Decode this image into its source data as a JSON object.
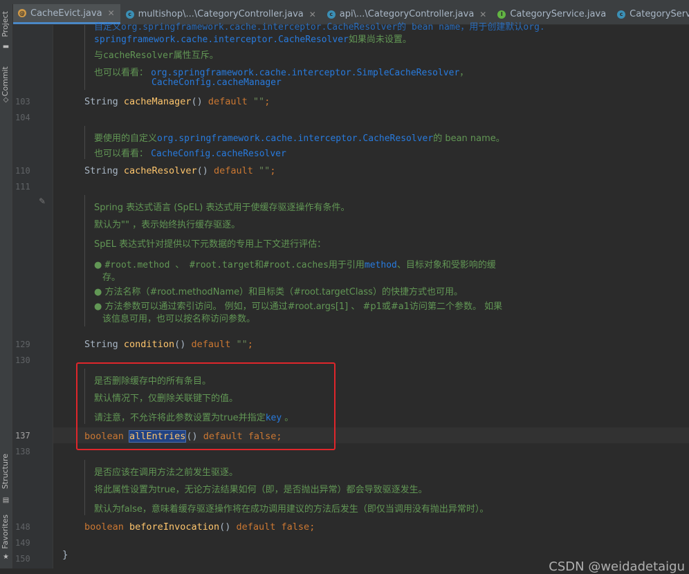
{
  "tabs": [
    {
      "label": "CacheEvict.java",
      "icon": "annotation-icon",
      "active": true,
      "closable": true
    },
    {
      "label": "multishop\\...\\CategoryController.java",
      "icon": "class-icon",
      "closable": true
    },
    {
      "label": "api\\...\\CategoryController.java",
      "icon": "class-icon",
      "closable": true
    },
    {
      "label": "CategoryService.java",
      "icon": "interface-icon",
      "closable": false
    },
    {
      "label": "CategoryServiceImpl.java",
      "icon": "class-icon",
      "closable": false
    }
  ],
  "close_glyph": "✕",
  "sidebar": {
    "project": "Project",
    "commit": "Commit",
    "structure": "Structure",
    "favorites": "Favorites"
  },
  "line_numbers": {
    "l103": "103",
    "l104": "104",
    "l110": "110",
    "l111": "111",
    "l129": "129",
    "l130": "130",
    "l137": "137",
    "l138": "138",
    "l148": "148",
    "l149": "149",
    "l150": "150"
  },
  "doc1": {
    "top_partial": "自定义org.springframework.cache.interceptor.CacheResolver的 bean name，用于创建默认org.",
    "line1_link": "springframework.cache.interceptor.CacheResolver",
    "line1_text": "如果尚未设置。",
    "line2_pre": "与",
    "line2_code": "cacheResolver",
    "line2_post": "属性互斥。",
    "see_label": "也可以看看：",
    "see_link1": "org.springframework.cache.interceptor.SimpleCacheResolver",
    "see_sep": "，",
    "see_link2": "CacheConfig.cacheManager"
  },
  "code103": {
    "type": "String",
    "name": "cacheManager",
    "parens": "()",
    "kw": "default",
    "value": "\"\"",
    "end": ";"
  },
  "doc2": {
    "pre": "要使用的自定义",
    "link": "org.springframework.cache.interceptor.CacheResolver",
    "post": "的 bean name。",
    "see_label": "也可以看看：",
    "see_link": "CacheConfig.cacheResolver"
  },
  "code110": {
    "type": "String",
    "name": "cacheResolver",
    "parens": "()",
    "kw": "default",
    "value": "\"\"",
    "end": ";"
  },
  "doc3": {
    "l1": "Spring 表达式语言 (SpEL) 表达式用于使缓存驱逐操作有条件。",
    "l2": "默认为\"\" ，表示始终执行缓存驱逐。",
    "l3": "SpEL 表达式针对提供以下元数据的专用上下文进行评估：",
    "b1a": "#root.method 、 #root.target和#root.caches用于引用",
    "b1b": "method",
    "b1c": "、目标对象和受影响的缓",
    "b1d": "存。",
    "b2": "方法名称（#root.methodName）和目标类（#root.targetClass）的快捷方式也可用。",
    "b3a": "方法参数可以通过索引访问。 例如，可以通过#root.args[1] 、 #p1或#a1访问第二个参数。 如果",
    "b3b": "该信息可用，也可以按名称访问参数。"
  },
  "code129": {
    "type": "String",
    "name": "condition",
    "parens": "()",
    "kw": "default",
    "value": "\"\"",
    "end": ";"
  },
  "doc4": {
    "l1": "是否删除缓存中的所有条目。",
    "l2": "默认情况下，仅删除关联键下的值。",
    "l3_pre": "请注意，不允许将此参数设置为true并指定",
    "l3_link": "key",
    "l3_post": " 。"
  },
  "code137": {
    "type": "boolean",
    "name": "allEntries",
    "parens": "()",
    "kw": "default",
    "value": "false",
    "end": ";"
  },
  "doc5": {
    "l1": "是否应该在调用方法之前发生驱逐。",
    "l2": "将此属性设置为true，无论方法结果如何（即，是否抛出异常）都会导致驱逐发生。",
    "l3": "默认为false，意味着缓存驱逐操作将在成功调用建议的方法后发生（即仅当调用没有抛出异常时）。"
  },
  "code148": {
    "type": "boolean",
    "name": "beforeInvocation",
    "parens": "()",
    "kw": "default",
    "value": "false",
    "end": ";"
  },
  "closing_brace": "}",
  "watermark": "CSDN @weidadetaigu",
  "bullet_glyph": "●",
  "pencil_glyph": "✎"
}
